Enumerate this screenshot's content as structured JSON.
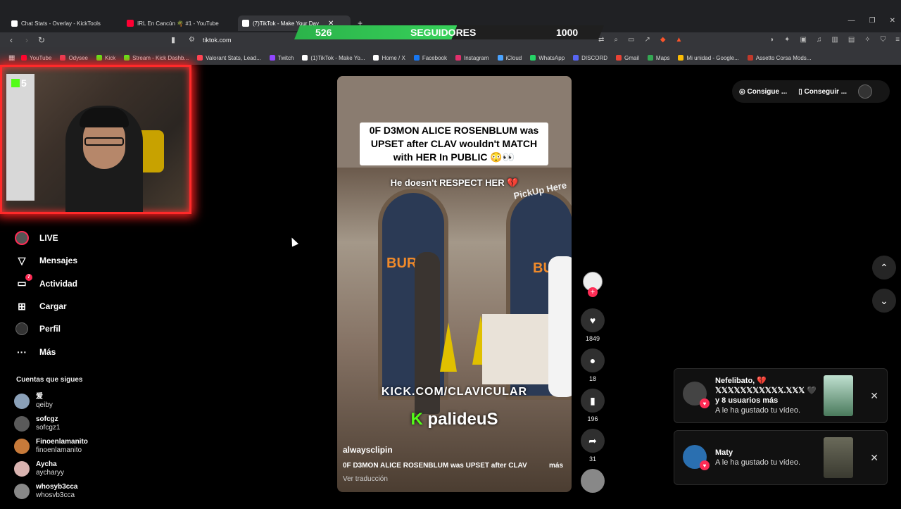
{
  "browser": {
    "tabs": [
      {
        "label": "Chat Stats - Overlay - KickTools",
        "icon": "grid-icon",
        "color": "#ffffff"
      },
      {
        "label": "IRL En Cancún 🌴 #1 - YouTube",
        "icon": "youtube-icon",
        "color": "#ff0033"
      },
      {
        "label": "(7)TikTok - Make Your Day",
        "icon": "tiktok-icon",
        "color": "#ffffff"
      }
    ],
    "new_tab": "+",
    "url": "tiktok.com",
    "bookmarks": [
      {
        "label": "YouTube",
        "color": "#ff0033"
      },
      {
        "label": "Odysee",
        "color": "#e8405a"
      },
      {
        "label": "Kick",
        "color": "#53fc18"
      },
      {
        "label": "Stream - Kick Dashb...",
        "color": "#53fc18"
      },
      {
        "label": "Valorant Stats, Lead...",
        "color": "#ff4655"
      },
      {
        "label": "Twitch",
        "color": "#9146ff"
      },
      {
        "label": "(1)TikTok - Make Yo...",
        "color": "#ffffff"
      },
      {
        "label": "Home / X",
        "color": "#ffffff"
      },
      {
        "label": "Facebook",
        "color": "#1877f2"
      },
      {
        "label": "Instagram",
        "color": "#e1306c"
      },
      {
        "label": "iCloud",
        "color": "#4aa3ff"
      },
      {
        "label": "WhatsApp",
        "color": "#25d366"
      },
      {
        "label": "DISCORD",
        "color": "#5865f2"
      },
      {
        "label": "Gmail",
        "color": "#ea4335"
      },
      {
        "label": "Maps",
        "color": "#34a853"
      },
      {
        "label": "Mi unidad - Google...",
        "color": "#fbbc04"
      },
      {
        "label": "Assetto Corsa Mods...",
        "color": "#c0392b"
      }
    ]
  },
  "overlay": {
    "followers_current": "526",
    "followers_label": "SEGUIDORES",
    "followers_goal": "1000",
    "progress_fraction": 0.526,
    "kick_badge": "5"
  },
  "sidebar": {
    "items": [
      {
        "label": "LIVE",
        "icon": "live-icon"
      },
      {
        "label": "Mensajes",
        "icon": "send-icon"
      },
      {
        "label": "Actividad",
        "icon": "activity-icon",
        "badge": "7"
      },
      {
        "label": "Cargar",
        "icon": "upload-icon"
      },
      {
        "label": "Perfil",
        "icon": "profile-icon"
      },
      {
        "label": "Más",
        "icon": "more-icon"
      }
    ],
    "following_title": "Cuentas que sigues",
    "following": [
      {
        "name": "爱",
        "handle": "qeiby",
        "color": "#8aa0b8"
      },
      {
        "name": "sofcgz",
        "handle": "sofcgz1",
        "color": "#5a5a5a"
      },
      {
        "name": "Finoenlamanito",
        "handle": "finoenlamanito",
        "color": "#c77a3a"
      },
      {
        "name": "Aycha",
        "handle": "aycharyy",
        "color": "#d9b3b0"
      },
      {
        "name": "whosyb3cca",
        "handle": "whosvb3cca",
        "color": "#888888"
      }
    ]
  },
  "video": {
    "caption": "0F D3MON ALICE ROSENBLUM was UPSET after CLAV wouldn't MATCH with HER In PUBLIC 😳👀",
    "subtitle": "He doesn't RESPECT HER 💔",
    "sign_text": "PickUp Here",
    "kick_url": "KICK.COM/CLAVICULAR",
    "kick_name": "palideuS",
    "author": "alwaysclipin",
    "description": "0F D3MON ALICE ROSENBLUM was UPSET after CLAV",
    "more": "más",
    "translate": "Ver traducción"
  },
  "actions": {
    "likes": "1849",
    "comments": "18",
    "saves": "196",
    "shares": "31"
  },
  "top_buttons": {
    "coins": "Consigue ...",
    "app": "Conseguir ..."
  },
  "notifications": [
    {
      "title": "Nefelibato, 💔",
      "line2": "𝕏𝕏𝕏𝕏𝕏𝕏𝕏𝕏𝕏𝕏𝕏.𝕏𝕏𝕏 🖤 y 8 usuarios más",
      "line3": "A le ha gustado tu vídeo."
    },
    {
      "title": "Maty",
      "line3": "A le ha gustado tu vídeo."
    }
  ]
}
